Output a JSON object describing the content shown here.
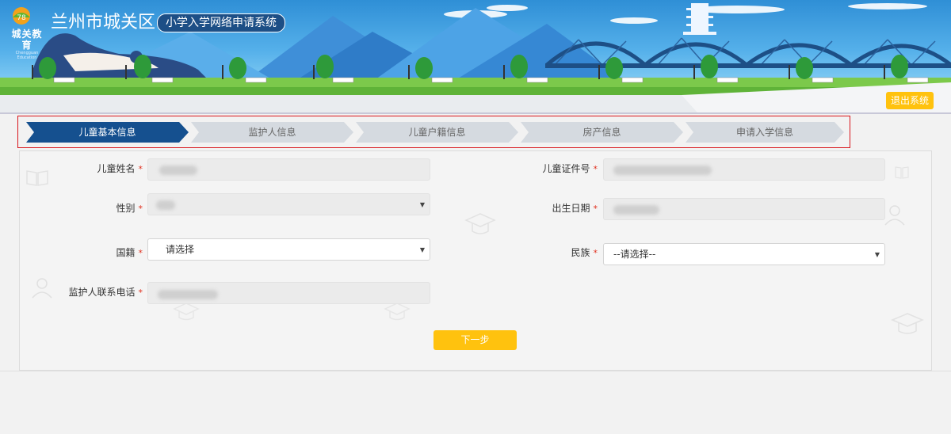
{
  "header": {
    "logo_text": "城关教育",
    "logo_sub": "Chengguan Education",
    "city_title": "兰州市城关区",
    "system_title": "小学入学网络申请系统",
    "exit_label": "退出系统"
  },
  "steps": [
    {
      "label": "儿童基本信息",
      "active": true
    },
    {
      "label": "监护人信息",
      "active": false
    },
    {
      "label": "儿童户籍信息",
      "active": false
    },
    {
      "label": "房产信息",
      "active": false
    },
    {
      "label": "申请入学信息",
      "active": false
    }
  ],
  "form": {
    "required_mark": "*",
    "child_name": {
      "label": "儿童姓名",
      "value": ""
    },
    "child_id": {
      "label": "儿童证件号",
      "value": ""
    },
    "gender": {
      "label": "性别",
      "value": ""
    },
    "birth_date": {
      "label": "出生日期",
      "value": ""
    },
    "nationality": {
      "label": "国籍",
      "value": "请选择"
    },
    "ethnicity": {
      "label": "民族",
      "value": "--请选择--"
    },
    "guardian_phone": {
      "label": "监护人联系电话",
      "value": ""
    }
  },
  "next_label": "下一步",
  "colors": {
    "active_step": "#15508f",
    "inactive_step": "#d5dae0",
    "accent_button": "#ffc20e",
    "required": "#e0301e",
    "highlight_border": "#d9151b"
  },
  "icons": [
    "book-icon",
    "graduation-cap-icon",
    "user-icon"
  ]
}
